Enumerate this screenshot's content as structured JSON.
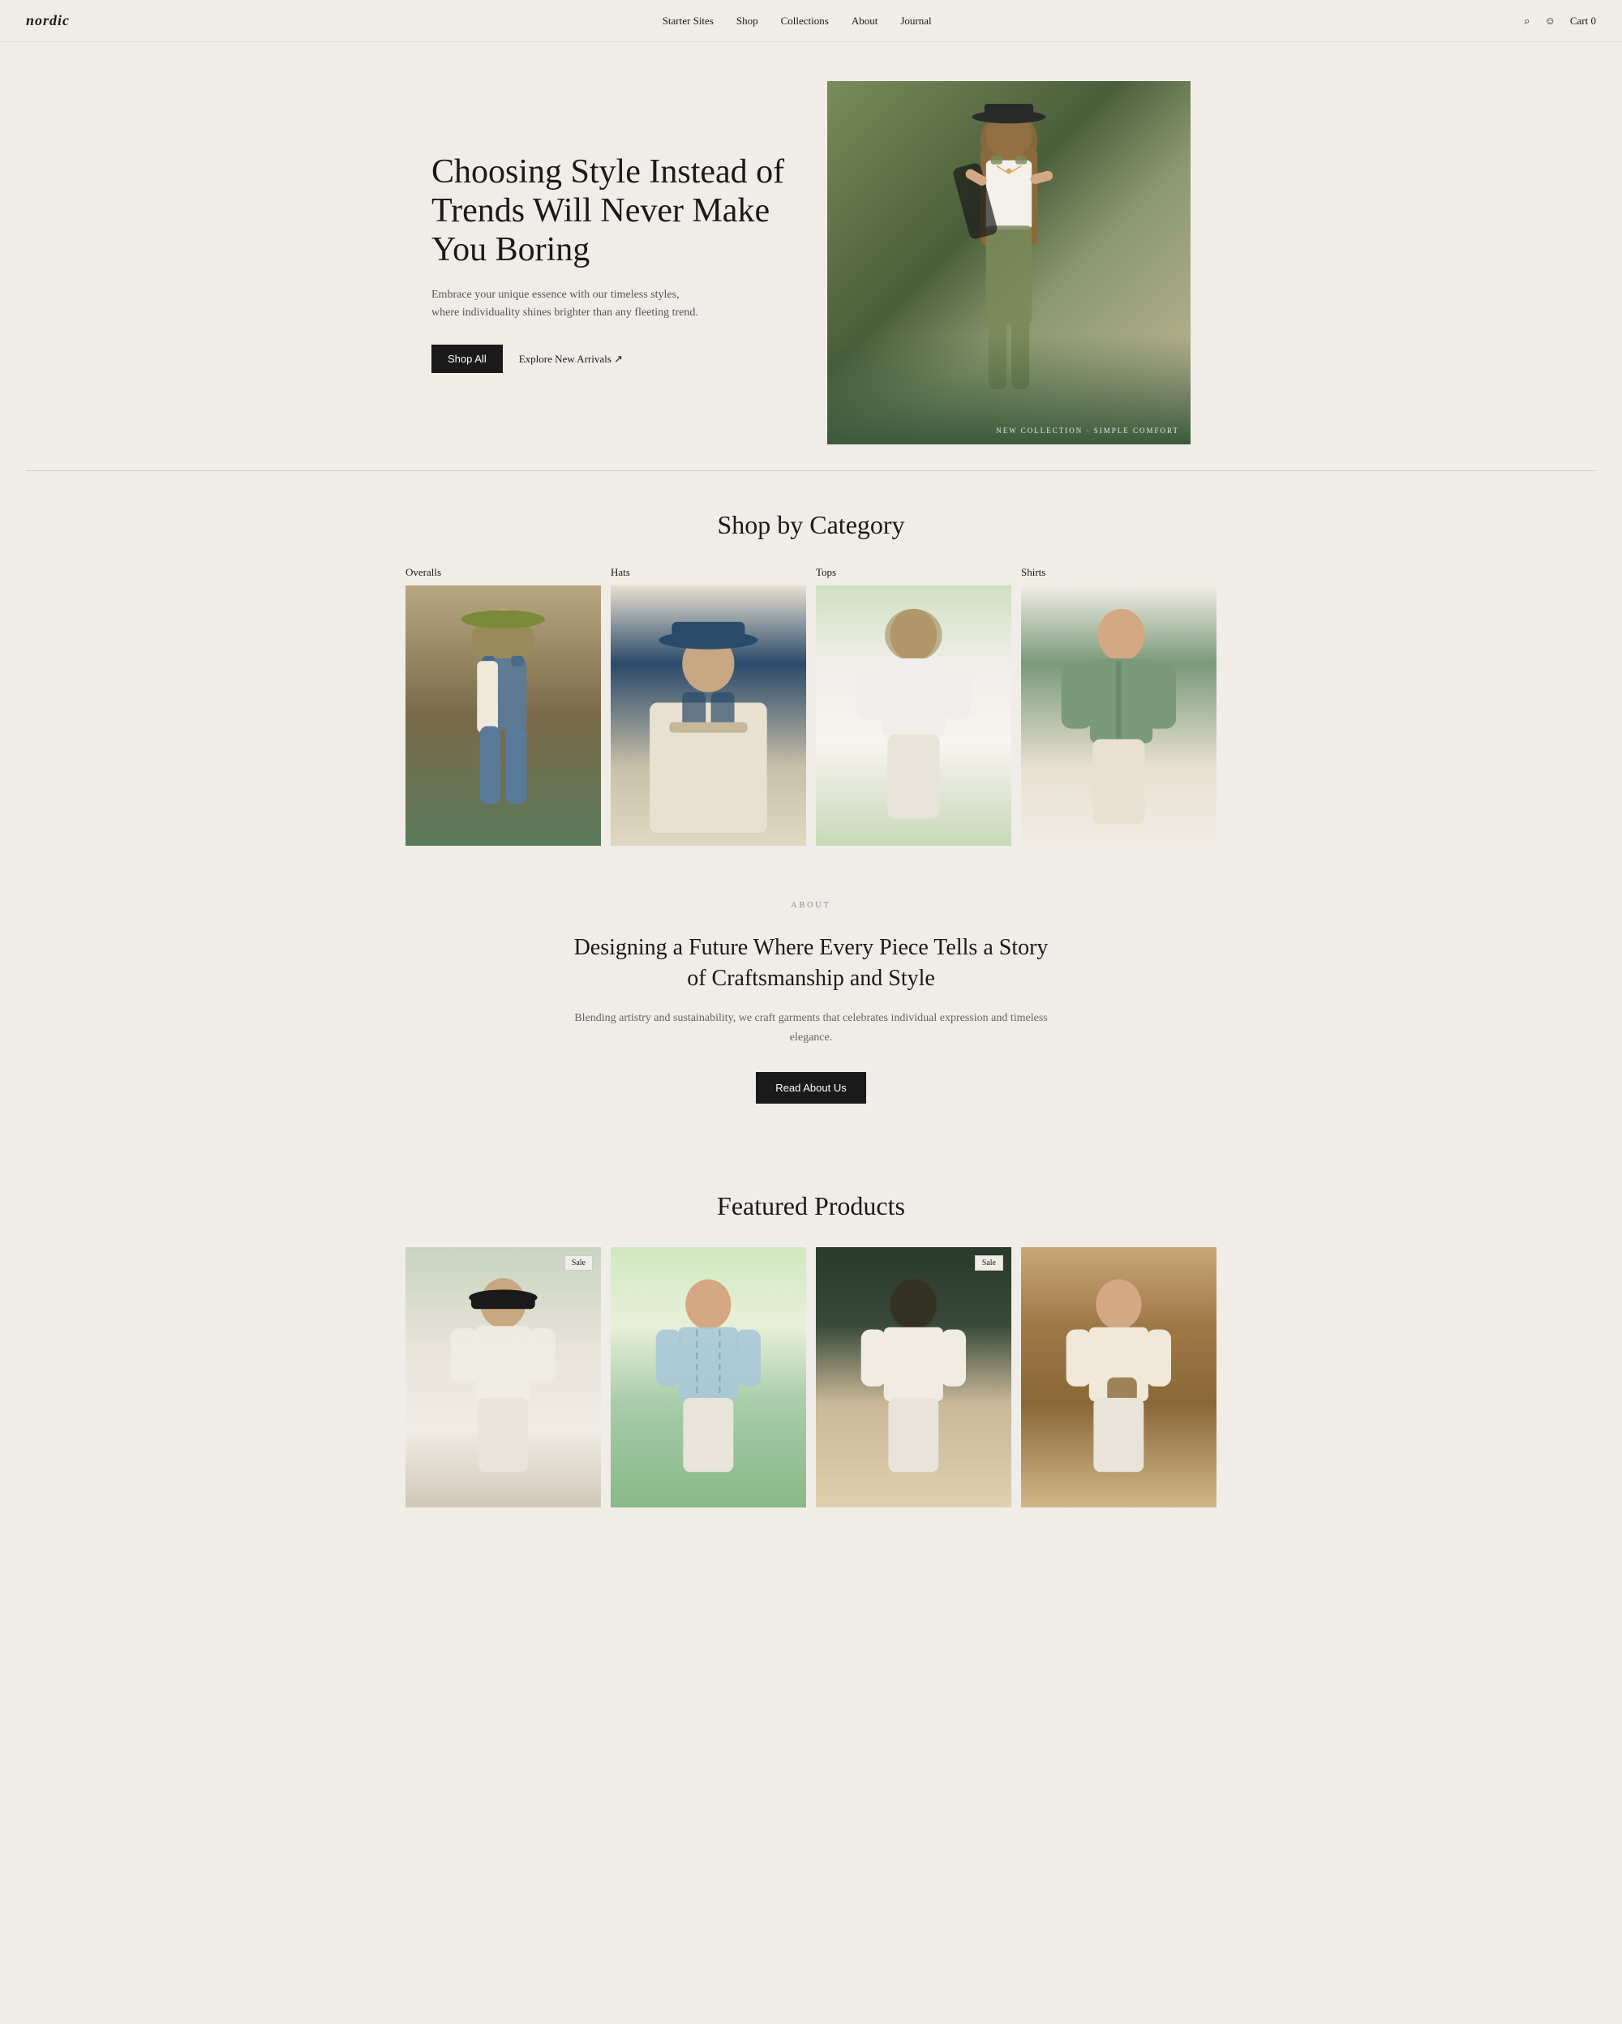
{
  "nav": {
    "logo": "nordic",
    "links": [
      "Starter Sites",
      "Shop",
      "Collections",
      "About",
      "Journal"
    ],
    "cart_label": "Cart",
    "cart_count": "0"
  },
  "hero": {
    "title": "Choosing Style Instead of Trends Will Never Make You Boring",
    "subtitle": "Embrace your unique essence with our timeless styles, where individuality shines brighter than any fleeting trend.",
    "shop_all_label": "Shop All",
    "explore_label": "Explore New Arrivals ↗",
    "image_label": "NEW COLLECTION · SIMPLE COMFORT"
  },
  "shop_by_category": {
    "title": "Shop by Category",
    "categories": [
      {
        "name": "Overalls",
        "class": "cat-img-overalls"
      },
      {
        "name": "Hats",
        "class": "cat-img-hats"
      },
      {
        "name": "Tops",
        "class": "cat-img-tops"
      },
      {
        "name": "Shirts",
        "class": "cat-img-shirts"
      }
    ]
  },
  "about": {
    "label": "ABOUT",
    "title": "Designing a Future Where Every Piece Tells a Story of Craftsmanship and Style",
    "subtitle": "Blending artistry and sustainability, we craft garments that celebrates individual expression and timeless elegance.",
    "cta_label": "Read About Us"
  },
  "featured_products": {
    "title": "Featured Products",
    "products": [
      {
        "sale": true,
        "img_class": "prod-img-1"
      },
      {
        "sale": false,
        "img_class": "prod-img-2"
      },
      {
        "sale": true,
        "img_class": "prod-img-3"
      },
      {
        "sale": false,
        "img_class": "prod-img-4"
      }
    ],
    "sale_label": "Sale"
  }
}
